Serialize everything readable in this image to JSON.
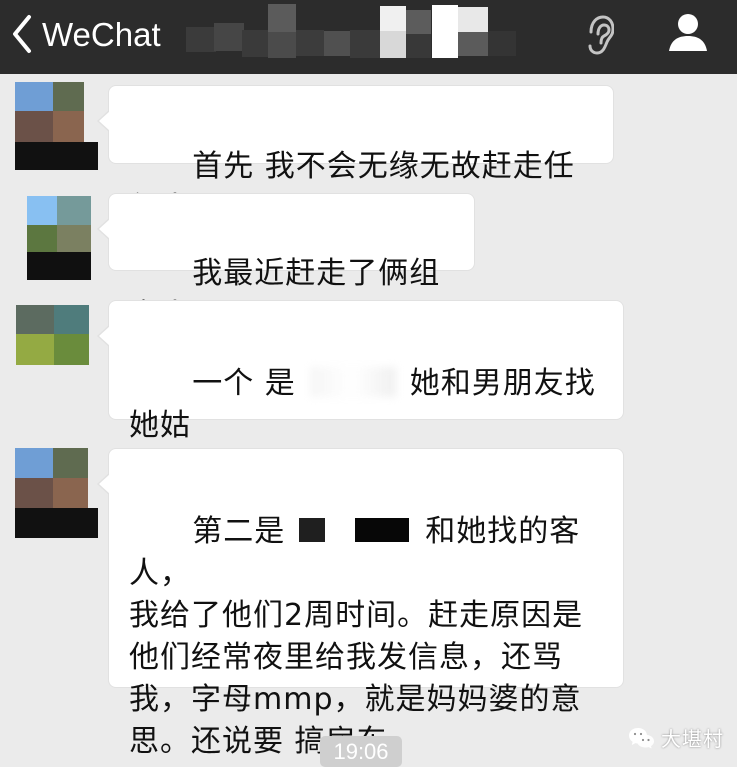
{
  "header": {
    "back_label": "WeChat",
    "title_state": "redacted",
    "voice_icon": "ear-voice-icon",
    "profile_icon": "profile-icon",
    "colors": {
      "background": "#2c2c2c",
      "foreground": "#ffffff"
    }
  },
  "messages": [
    {
      "segments": [
        {
          "text": "首先 我不会无缘无故赶走任何人"
        }
      ]
    },
    {
      "segments": [
        {
          "text": "我最近赶走了俩组客人"
        }
      ]
    },
    {
      "segments": [
        {
          "text": "一个 是"
        },
        {
          "redaction": "blurred-name"
        },
        {
          "text": "她和男朋友找她姑\n姑来恐吓我，这些我都有录音。"
        }
      ]
    },
    {
      "segments": [
        {
          "text": "第二是"
        },
        {
          "redaction": "black-box"
        },
        {
          "redaction": "black-box-wide"
        },
        {
          "text": "和她找的客人，\n我给了他们2周时间。赶走原因是\n他们经常夜里给我发信息，还骂\n我，字母mmp，就是妈妈婆的意\n思。还说要 搞房东。"
        }
      ]
    }
  ],
  "timestamp": "19:06",
  "watermark": {
    "text": "大堪村",
    "icon": "wechat-channel-icon"
  },
  "colors": {
    "chat_background": "#ebebeb",
    "bubble_background": "#ffffff",
    "bubble_border": "#e1e1e1",
    "message_text": "#111111",
    "timestamp_background": "#cfcfcf"
  }
}
